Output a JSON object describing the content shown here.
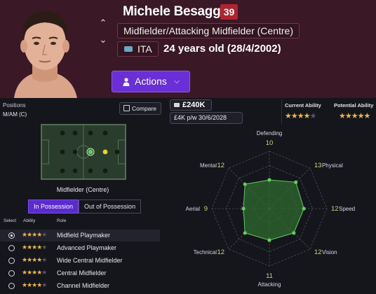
{
  "header": {
    "player_name": "Michele Besaggio",
    "number": "39",
    "position": "Midfielder/Attacking Midfielder (Centre)",
    "nationality": "ITA",
    "age_text": "24 years old (28/4/2002)",
    "actions_label": "Actions"
  },
  "left": {
    "positions_label": "Positions",
    "positions_value": "M/AM (C)",
    "compare_label": "Compare",
    "pitch_label": "Midfielder (Centre)",
    "tabs": [
      {
        "label": "In Possession",
        "active": true
      },
      {
        "label": "Out of Possession",
        "active": false
      }
    ],
    "role_headers": {
      "select": "Select",
      "ability": "Ability",
      "role": "Role"
    },
    "roles": [
      {
        "name": "Midfield Playmaker",
        "stars": 3.5,
        "selected": true
      },
      {
        "name": "Advanced Playmaker",
        "stars": 3.5,
        "selected": false
      },
      {
        "name": "Wide Central Midfielder",
        "stars": 3.5,
        "selected": false
      },
      {
        "name": "Central Midfielder",
        "stars": 3.5,
        "selected": false
      },
      {
        "name": "Channel Midfielder",
        "stars": 3.5,
        "selected": false
      }
    ]
  },
  "right": {
    "value": "£240K",
    "wage": "£4K p/w 30/6/2028",
    "current_ability_label": "Current Ability",
    "potential_ability_label": "Potential Ability",
    "current_ability_stars": 3.5,
    "potential_ability_stars": 4.5
  },
  "radar": {
    "attributes": [
      {
        "name": "Defending",
        "value": 10
      },
      {
        "name": "Physical",
        "value": 13
      },
      {
        "name": "Speed",
        "value": 12
      },
      {
        "name": "Vision",
        "value": 12
      },
      {
        "name": "Attacking",
        "value": 11
      },
      {
        "name": "Technical",
        "value": 12
      },
      {
        "name": "Aerial",
        "value": 9
      },
      {
        "name": "Mental",
        "value": 12
      }
    ],
    "max": 20
  },
  "colors": {
    "header_bg": "#3a1826",
    "accent": "#6a2fd6",
    "badge": "#b0242f",
    "star": "#e8b84a",
    "radar_fill": "#2f6a2f",
    "radar_point": "#5fce5f",
    "radar_value": "#b4e07a"
  }
}
